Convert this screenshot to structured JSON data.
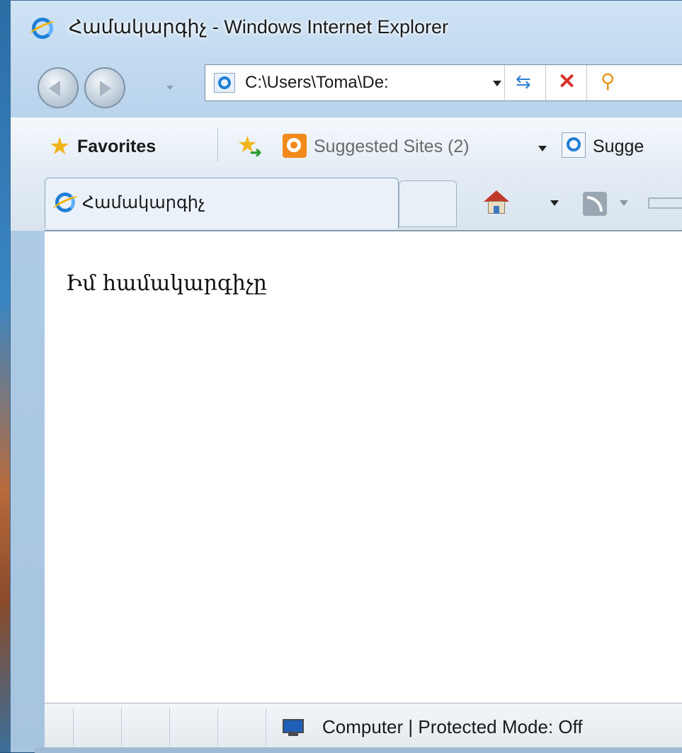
{
  "window": {
    "title": "Համակարգիչ - Windows Internet Explorer"
  },
  "navigation": {
    "back_icon": "back-arrow-icon",
    "forward_icon": "forward-arrow-icon",
    "address": "C:\\Users\\Toma\\De:",
    "refresh_icon": "refresh-icon",
    "stop_icon": "stop-icon",
    "search_icon": "live-search-icon"
  },
  "favorites_bar": {
    "favorites_label": "Favorites",
    "add_favorites_icon": "add-to-favorites-icon",
    "suggested_sites_label": "Suggested Sites (2)",
    "suggested_icon": "bing-icon",
    "second_suggested_label": "Sugge"
  },
  "tabs": [
    {
      "label": "Համակարգիչ",
      "active": true
    }
  ],
  "command_bar": {
    "home_icon": "home-icon",
    "feeds_icon": "feeds-icon",
    "mail_icon": "mail-icon"
  },
  "content": {
    "text": "Իմ համակարգիչը"
  },
  "status_bar": {
    "zone_text": "Computer | Protected Mode: Off",
    "zone_icon": "computer-icon"
  },
  "colors": {
    "accent_blue": "#1f7fd6",
    "stop_red": "#d9302a",
    "bing_orange": "#f18a1a",
    "star_gold": "#f1b51c"
  }
}
